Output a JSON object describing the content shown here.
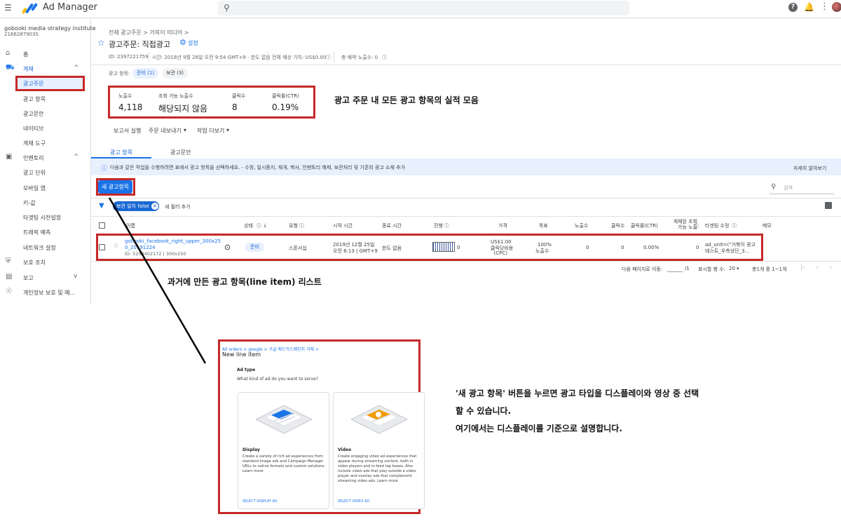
{
  "header": {
    "app_name": "Ad Manager",
    "search_placeholder": ""
  },
  "sidebar": {
    "network_name": "gobooki media strategy institute",
    "network_id": "2166287903S",
    "items": [
      {
        "label": "홈",
        "icon": "home-icon"
      },
      {
        "label": "게재",
        "icon": "truck-icon"
      },
      {
        "label": "광고주문"
      },
      {
        "label": "광고 항목"
      },
      {
        "label": "광고문안"
      },
      {
        "label": "네이티브"
      },
      {
        "label": "게재 도구"
      },
      {
        "label": "인벤토리",
        "icon": "inventory-icon"
      },
      {
        "label": "광고 단위"
      },
      {
        "label": "모바일 앱"
      },
      {
        "label": "키-값"
      },
      {
        "label": "타겟팅 사전설정"
      },
      {
        "label": "트래픽 예측"
      },
      {
        "label": "네트워크 설정"
      },
      {
        "label": "보호 조치",
        "icon": "shield-icon"
      },
      {
        "label": "보고",
        "icon": "report-icon"
      },
      {
        "label": "개인정보 보호 및 메...",
        "icon": "privacy-icon"
      }
    ]
  },
  "order": {
    "breadcrumb": "전체 광고주문 > 거북이 미디어 >",
    "title": "광고주문: 직접광고",
    "settings_label": "설정",
    "id_text": "ID: 2397221759",
    "time_text": "시간: 2018년 9월 28일 오전 9:54 GMT+9 - 한도 없음",
    "value_text": "전체 예상 가치: US$0.00",
    "reserved_text": "총 예약 노출수: 0"
  },
  "status_filter": {
    "label": "광고 항목:",
    "chips": [
      "준비 (1)",
      "보관 (3)"
    ]
  },
  "stats": [
    {
      "label": "노출수",
      "value": "4,118"
    },
    {
      "label": "조회 가능 노출수",
      "value": "해당되지 않음"
    },
    {
      "label": "클릭수",
      "value": "8"
    },
    {
      "label": "클릭률(CTR)",
      "value": "0.19%"
    }
  ],
  "annotations": {
    "stats_note": "광고 주문 내 모든 광고 항목의 실적 모음",
    "list_note": "과거에 만든 광고 항목(line item) 리스트",
    "new_btn_note_1": "'새 광고 항목' 버튼을 누르면 광고 타입을 디스플레이와 영상 중 선택",
    "new_btn_note_2": "할 수 있습니다.",
    "new_btn_note_3": "여기에서는 디스플레이를 기준으로 설명합니다."
  },
  "actions": {
    "run_report": "보고서 실행",
    "export": "주문 내보내기",
    "more": "작업 더보기"
  },
  "tabs": [
    "광고 항목",
    "광고문안"
  ],
  "info_bar": {
    "text": "다음과 같은 작업을 수행하려면 표에서 광고 항목을 선택하세요. - 수정, 일시중지, 재개, 복사, 인벤토리 해제, 보관처리 및 기존의 광고 소재 추가",
    "learn_more": "자세히 알아보기"
  },
  "toolbar": {
    "new_button": "새 광고항목",
    "search_placeholder": "검색",
    "filter_chip": "보관 일치 false",
    "add_filter": "새 필터 추가"
  },
  "table": {
    "headers": [
      "이름",
      "상태",
      "유형",
      "시작 시간",
      "종료 시간",
      "진행",
      "가격",
      "목표",
      "노출수",
      "클릭수",
      "클릭률(CTR)",
      "게재된 조회 가능 노출",
      "타겟팅 수정",
      "메모"
    ],
    "rows": [
      {
        "name_line1": "gobooki_facebook_right_upper_300x25",
        "name_line2": "0_20191224",
        "id_line": "ID: 5253402172 | 300x250",
        "status": "준비",
        "type": "스폰서십",
        "start_1": "2019년 12월 25일",
        "start_2": "오전 6:13 | GMT+9",
        "end": "한도 없음",
        "progress_value": "0",
        "price_1": "US$1.00",
        "price_2": "클릭당비용",
        "price_3": "(CPC)",
        "goal_1": "100%",
        "goal_2": "노출수",
        "impressions": "0",
        "clicks": "0",
        "ctr": "0.00%",
        "viewable": "0",
        "targeting_1": "ad_unit=(\"거북이 광고",
        "targeting_2": "테스트_우측상단_3..."
      }
    ]
  },
  "pagination": {
    "go_to": "다음 페이지로 이동:",
    "of_pages": "/1",
    "rows_per_page": "표시할 행 수:",
    "rows_value": "20",
    "range": "총1개 중 1~1개"
  },
  "dialog": {
    "breadcrumb": "All orders > google > 구글 애드익스체인지 거래 >",
    "title": "New line item",
    "section": "Ad type",
    "question": "What kind of ad do you want to serve?",
    "cards": [
      {
        "title": "Display",
        "desc": "Create a variety of rich ad experiences from standard image ads and Campaign Manager URLs to native formats and custom solutions. Learn more",
        "link": "SELECT DISPLAY AD",
        "accent": "#1a73e8"
      },
      {
        "title": "Video",
        "desc": "Create engaging video ad experiences that appear during streaming content, both in video players and in-feed tap boxes. Also include video ads that play outside a video player and overlay ads that complement streaming video ads. Learn more",
        "link": "SELECT VIDEO AD",
        "accent": "#f29900"
      }
    ]
  }
}
